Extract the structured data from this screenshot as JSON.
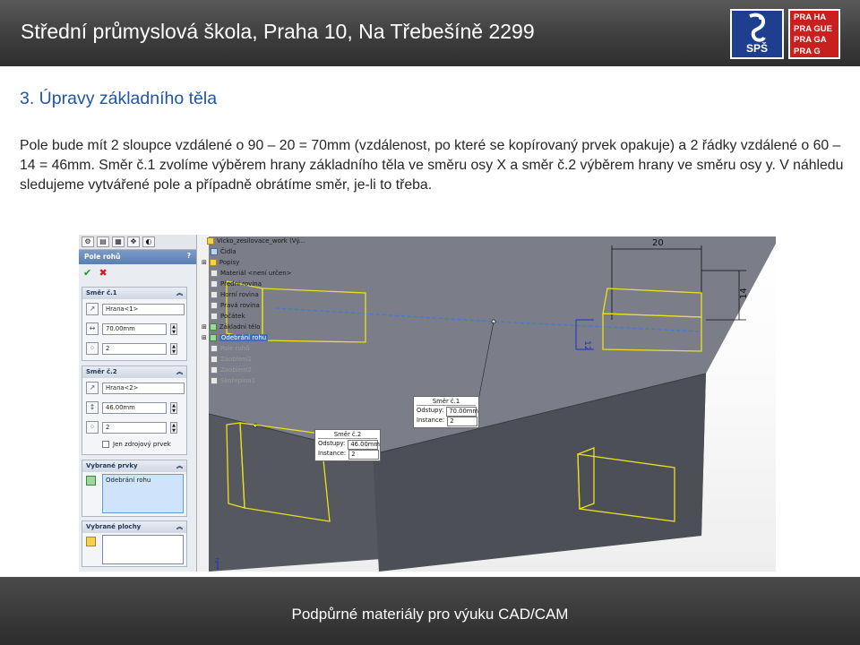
{
  "header": {
    "title": "Střední průmyslová škola, Praha 10, Na Třebešíně 2299",
    "logo_left": "SPŠ",
    "logo_right_lines": [
      "PRA HA",
      "PRA GUE",
      "PRA GA",
      "PRA G"
    ]
  },
  "section": {
    "title": "3. Úpravy základního těla",
    "paragraph": "Pole bude mít 2 sloupce vzdálené o 90 – 20 = 70mm (vzdálenost, po které se kopírovaný prvek opakuje) a 2 řádky vzdálené o 60 – 14 = 46mm. Směr č.1 zvolíme výběrem hrany základního těla ve směru osy X a směr č.2 výběrem hrany ve směru osy y. V náhledu sledujeme vytvářené pole a případně obrátíme směr, je-li to třeba."
  },
  "footer": {
    "text": "Podpůrné materiály pro výuku CAD/CAM"
  },
  "property_manager": {
    "title": "Pole rohů",
    "help": "?",
    "ok": "✔",
    "cancel": "✖",
    "direction1": {
      "header": "Směr č.1",
      "edge": "Hrana<1>",
      "spacing": "70.00mm",
      "instances": "2"
    },
    "direction2": {
      "header": "Směr č.2",
      "edge": "Hrana<2>",
      "spacing": "46.00mm",
      "instances": "2",
      "seed_only_label": "Jen zdrojový prvek"
    },
    "selected_features": {
      "header": "Vybrané prvky",
      "item": "Odebrání rohu"
    },
    "selected_faces": {
      "header": "Vybrané plochy"
    }
  },
  "feature_tree": {
    "root": "Vicko_zesilovace_work  (Vý...",
    "items": [
      "Čidla",
      "Popisy",
      "Materiál <není určen>",
      "Přední rovina",
      "Horní rovina",
      "Pravá rovina",
      "Počátek",
      "Základní tělo",
      "Odebrání rohu",
      "Pole rohů",
      "Zaoblení1",
      "Zaoblení2",
      "Skořepina1"
    ]
  },
  "viewport": {
    "dim_top": "20",
    "dim_right": "14",
    "dim_small": "12",
    "callout1": {
      "title": "Směr č.1",
      "spacing_label": "Odstupy:",
      "spacing": "70.00mm",
      "instances_label": "Instance:",
      "instances": "2"
    },
    "callout2": {
      "title": "Směr č.2",
      "spacing_label": "Odstupy:",
      "spacing": "46.00mm",
      "instances_label": "Instance:",
      "instances": "2"
    },
    "triad_label": "Z"
  },
  "colors": {
    "header_bg": "#3c3c3c",
    "title_blue": "#1f56a5",
    "logo_blue": "#1e3f8f",
    "logo_red": "#c8201e",
    "body_gray": "#5a5d66",
    "preview_yellow": "#e8e020"
  }
}
